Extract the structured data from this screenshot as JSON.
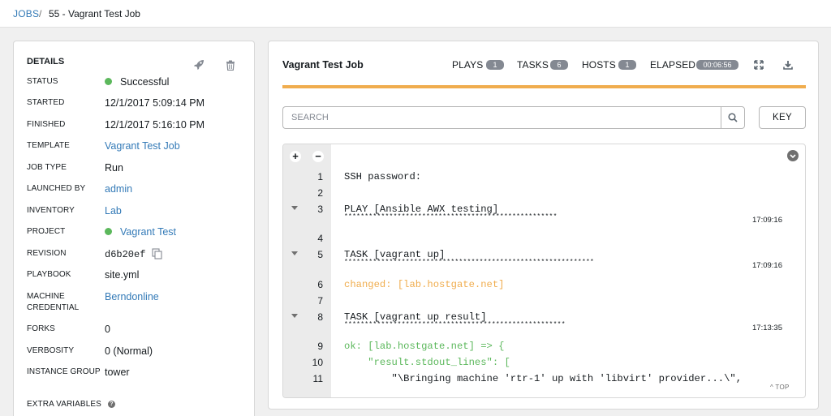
{
  "breadcrumb": {
    "root": "JOBS",
    "separator": "/",
    "current": "55 - Vagrant Test Job"
  },
  "details": {
    "title": "DETAILS",
    "relaunch_icon": "rocket-icon",
    "delete_icon": "trash-icon",
    "rows": [
      {
        "label": "STATUS",
        "value": "Successful",
        "status_color": "#5cb85c"
      },
      {
        "label": "STARTED",
        "value": "12/1/2017 5:09:14 PM"
      },
      {
        "label": "FINISHED",
        "value": "12/1/2017 5:16:10 PM"
      },
      {
        "label": "TEMPLATE",
        "value": "Vagrant Test Job"
      },
      {
        "label": "JOB TYPE",
        "value": "Run"
      },
      {
        "label": "LAUNCHED BY",
        "value": "admin"
      },
      {
        "label": "INVENTORY",
        "value": "Lab"
      },
      {
        "label": "PROJECT",
        "value": "Vagrant Test",
        "status_color": "#5cb85c"
      },
      {
        "label": "REVISION",
        "value": "d6b20ef",
        "icon": "copy-icon"
      },
      {
        "label": "PLAYBOOK",
        "value": "site.yml"
      },
      {
        "label": "MACHINE CREDENTIAL",
        "value": "Berndonline"
      },
      {
        "label": "FORKS",
        "value": "0"
      },
      {
        "label": "VERBOSITY",
        "value": "0 (Normal)"
      },
      {
        "label": "INSTANCE GROUP",
        "value": "tower"
      },
      {
        "label": "EXTRA VARIABLES",
        "value": "",
        "icon": "help-icon"
      }
    ]
  },
  "output": {
    "title": "Vagrant Test Job",
    "stats": {
      "plays_label": "PLAYS",
      "plays": "1",
      "tasks_label": "TASKS",
      "tasks": "6",
      "hosts_label": "HOSTS",
      "hosts": "1",
      "elapsed_label": "ELAPSED",
      "elapsed": "00:06:56"
    },
    "header_icons": [
      "expand-icon",
      "download-icon"
    ],
    "progress_color": "#f0ad4e",
    "search_placeholder": "SEARCH",
    "search_icon": "search-icon",
    "key_label": "KEY",
    "expand_all": "+",
    "collapse_all": "−",
    "top_label": "^ TOP",
    "lines": [
      {
        "num": "1",
        "text": "SSH password:",
        "kind": "plain"
      },
      {
        "num": "2",
        "text": "",
        "kind": "plain"
      },
      {
        "num": "3",
        "text": "PLAY [Ansible AWX testing]",
        "kind": "plain",
        "collapsible": true,
        "stars": "****************************************************",
        "time": "17:09:16"
      },
      {
        "num": "4",
        "text": "",
        "kind": "plain"
      },
      {
        "num": "5",
        "text": "TASK [vagrant up]",
        "kind": "plain",
        "collapsible": true,
        "stars": "*************************************************************",
        "time": "17:09:16"
      },
      {
        "num": "6",
        "text": "changed: [lab.hostgate.net]",
        "kind": "changed"
      },
      {
        "num": "7",
        "text": "",
        "kind": "plain"
      },
      {
        "num": "8",
        "text": "TASK [vagrant up result]",
        "kind": "plain",
        "collapsible": true,
        "stars": "******************************************************",
        "time": "17:13:35"
      },
      {
        "num": "9",
        "text": "ok: [lab.hostgate.net] => {",
        "kind": "ok"
      },
      {
        "num": "10",
        "text": "    \"result.stdout_lines\": [",
        "kind": "ok"
      },
      {
        "num": "11",
        "text": "        \"\\Bringing machine 'rtr-1' up with 'libvirt' provider...\\\",",
        "kind": "plain"
      }
    ]
  }
}
